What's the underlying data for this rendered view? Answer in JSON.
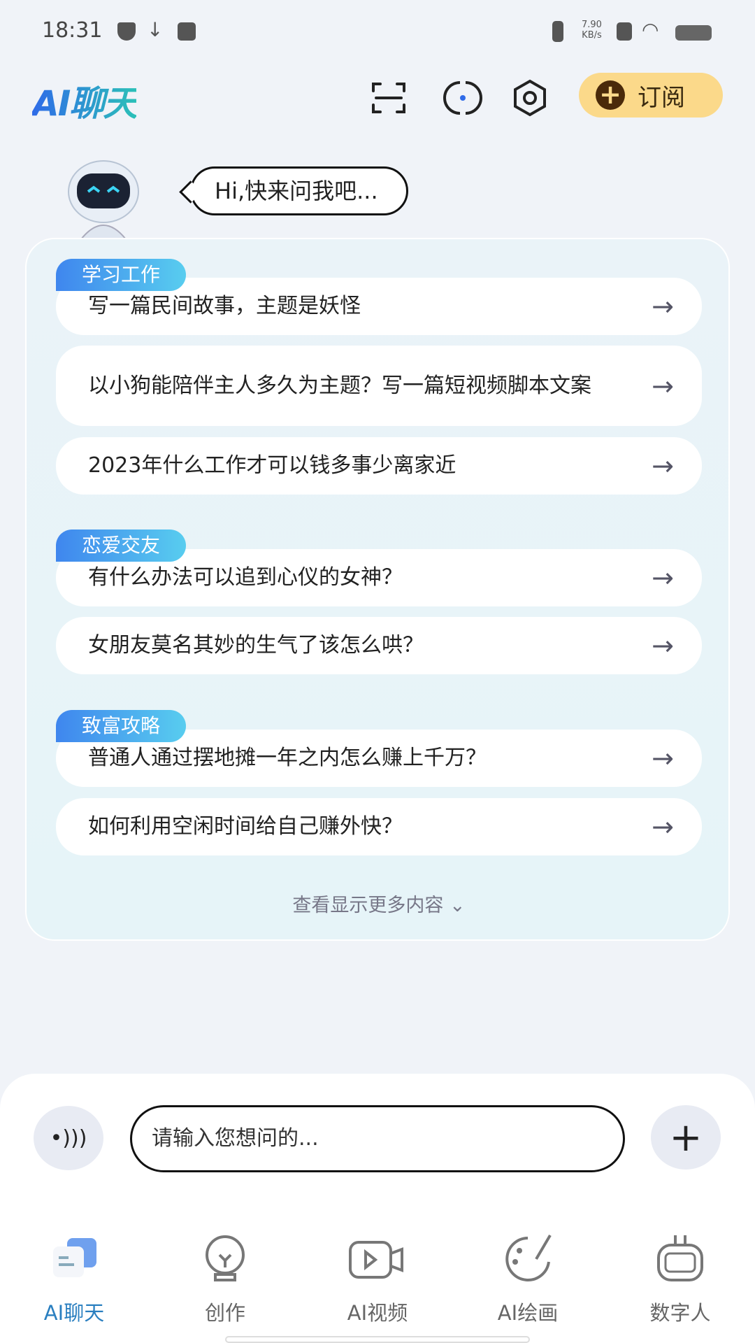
{
  "status": {
    "time": "18:31",
    "speed_value": "7.90",
    "speed_unit": "KB/s"
  },
  "header": {
    "logo": "AI聊天",
    "subscribe_label": "订阅",
    "accent": "#fbd98a"
  },
  "greeting": "Hi,快来问我吧...",
  "sections": [
    {
      "tag": "学习工作",
      "items": [
        "写一篇民间故事，主题是妖怪",
        "以小狗能陪伴主人多久为主题？写一篇短视频脚本文案",
        "2023年什么工作才可以钱多事少离家近"
      ]
    },
    {
      "tag": "恋爱交友",
      "items": [
        "有什么办法可以追到心仪的女神？",
        "女朋友莫名其妙的生气了该怎么哄？"
      ]
    },
    {
      "tag": "致富攻略",
      "items": [
        "普通人通过摆地摊一年之内怎么赚上千万？",
        "如何利用空闲时间给自己赚外快？"
      ]
    }
  ],
  "more_label": "查看显示更多内容",
  "input": {
    "placeholder": "请输入您想问的..."
  },
  "tabs": [
    {
      "label": "AI聊天",
      "active": true
    },
    {
      "label": "创作"
    },
    {
      "label": "AI视频"
    },
    {
      "label": "AI绘画"
    },
    {
      "label": "数字人"
    }
  ]
}
